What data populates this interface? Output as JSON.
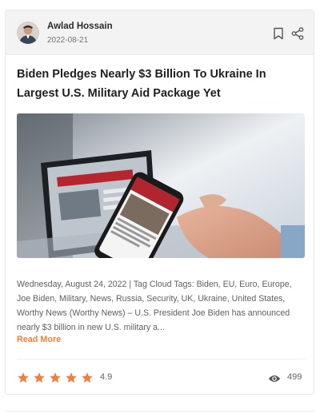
{
  "post": {
    "author_name": "Awlad Hossain",
    "date": "2022-08-21",
    "title": "Biden Pledges Nearly $3 Billion To Ukraine In Largest U.S. Military Aid Package Yet",
    "excerpt": "Wednesday, August 24, 2022 | Tag Cloud Tags: Biden, EU, Euro, Europe, Joe Biden, Military, News, Russia, Security, UK, Ukraine, United States, Worthy News (Worthy News) – U.S. President Joe Biden has announced nearly $3 billion in new U.S. military a...",
    "read_more_label": "Read More",
    "rating": "4.9",
    "rating_stars": 5,
    "views": "499"
  },
  "icons": {
    "bookmark": "bookmark-icon",
    "share": "share-icon",
    "star": "star-icon",
    "views": "eye-icon"
  },
  "colors": {
    "accent": "#f07f3c",
    "title": "#1f1f1f",
    "header_bg": "#f3f3f3"
  }
}
